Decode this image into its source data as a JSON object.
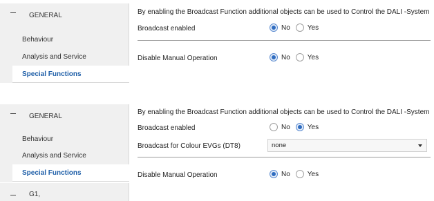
{
  "panel1": {
    "sidebar": {
      "group": "GENERAL",
      "items": [
        {
          "label": "Behaviour"
        },
        {
          "label": "Analysis and Service"
        },
        {
          "label": "Special Functions",
          "active": true
        }
      ]
    },
    "info": "By enabling the Broadcast Function additional objects can be used to Control the DALI -System",
    "broadcast": {
      "label": "Broadcast enabled",
      "options": [
        "No",
        "Yes"
      ],
      "selected": "No"
    },
    "manual": {
      "label": "Disable Manual Operation",
      "options": [
        "No",
        "Yes"
      ],
      "selected": "No"
    }
  },
  "panel2": {
    "sidebar": {
      "group": "GENERAL",
      "items": [
        {
          "label": "Behaviour"
        },
        {
          "label": "Analysis and Service"
        },
        {
          "label": "Special Functions",
          "active": true
        }
      ],
      "group2": "G1,"
    },
    "info": "By enabling the Broadcast Function additional objects can be used to Control the DALI -System",
    "broadcast": {
      "label": "Broadcast enabled",
      "options": [
        "No",
        "Yes"
      ],
      "selected": "Yes"
    },
    "colour": {
      "label": "Broadcast for Colour EVGs (DT8)",
      "value": "none"
    },
    "manual": {
      "label": "Disable Manual Operation",
      "options": [
        "No",
        "Yes"
      ],
      "selected": "No"
    }
  },
  "icons": {
    "collapse": "minus-icon",
    "dropdown": "chevron-down-icon",
    "radio": "radio-icon"
  }
}
